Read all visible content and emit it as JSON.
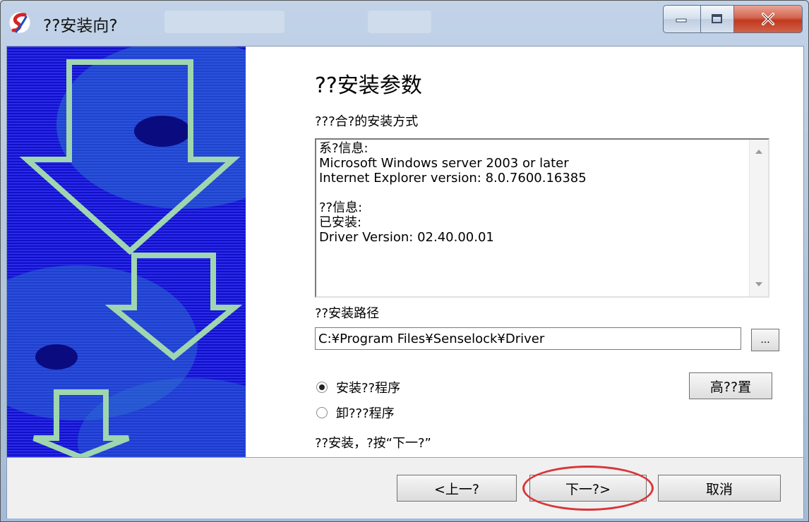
{
  "window": {
    "title": "??安装向?",
    "minimize_icon": "minimize-icon",
    "maximize_icon": "maximize-icon",
    "close_icon": "close-icon",
    "close_accent": "#c1391f"
  },
  "banner": {
    "background": "#1515d8",
    "arrow_color": "#9fd6b0"
  },
  "main": {
    "heading": "??安装参数",
    "subheading": "???合?的安装方式",
    "info_text": "系?信息:\nMicrosoft Windows server 2003 or later\nInternet Explorer version: 8.0.7600.16385\n\n??信息:\n已安装:\nDriver Version: 02.40.00.01",
    "path_label": "??安装路径",
    "path_value": "C:¥Program Files¥Senselock¥Driver",
    "browse_label": "...",
    "radio_install": "安装??程序",
    "radio_uninstall": "卸???程序",
    "selected_option": "install",
    "advanced_label": "高??置",
    "hint": "??安装，?按“下一?”"
  },
  "footer": {
    "back_label": "<上一?",
    "next_label": "下一?>",
    "cancel_label": "取消",
    "highlight_color": "#d9363a"
  }
}
